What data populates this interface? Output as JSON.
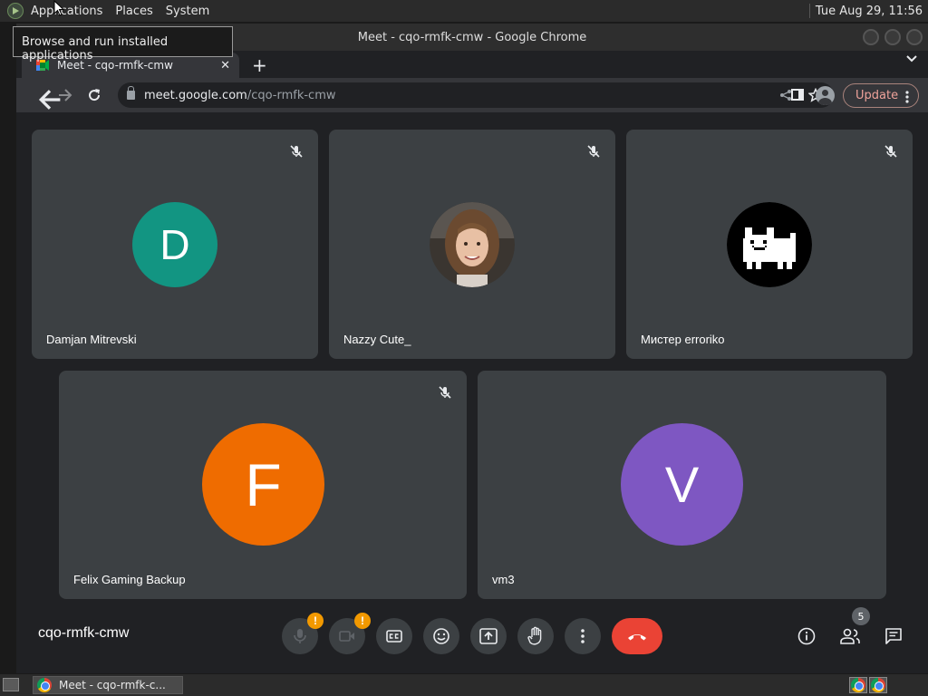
{
  "panel": {
    "menus": [
      "Applications",
      "Places",
      "System"
    ],
    "clock": "Tue Aug 29, 11:56"
  },
  "tooltip": "Browse and run installed applications",
  "window": {
    "title": "Meet - cqo-rmfk-cmw - Google Chrome"
  },
  "tab": {
    "title": "Meet - cqo-rmfk-cmw",
    "close": "✕",
    "new": "+"
  },
  "omnibox": {
    "host": "meet.google.com",
    "path": "/cqo-rmfk-cmw"
  },
  "update_label": "Update",
  "participants": [
    {
      "name": "Damjan Mitrevski",
      "initial": "D",
      "color": "#129582"
    },
    {
      "name": "Nazzy Cute_",
      "initial": "",
      "color": "#6b5a4a"
    },
    {
      "name": "Мистер erroriko",
      "initial": "",
      "color": "#000000"
    },
    {
      "name": "Felix Gaming Backup",
      "initial": "F",
      "color": "#ef6c00"
    },
    {
      "name": "vm3",
      "initial": "V",
      "color": "#7e57c2"
    }
  ],
  "meeting_code": "cqo-rmfk-cmw",
  "people_count": "5",
  "warning_mark": "!",
  "taskbar": {
    "item": "Meet - cqo-rmfk-c..."
  },
  "colors": {
    "hangup": "#ea4335",
    "tile": "#3c4043",
    "warning": "#f29900"
  }
}
